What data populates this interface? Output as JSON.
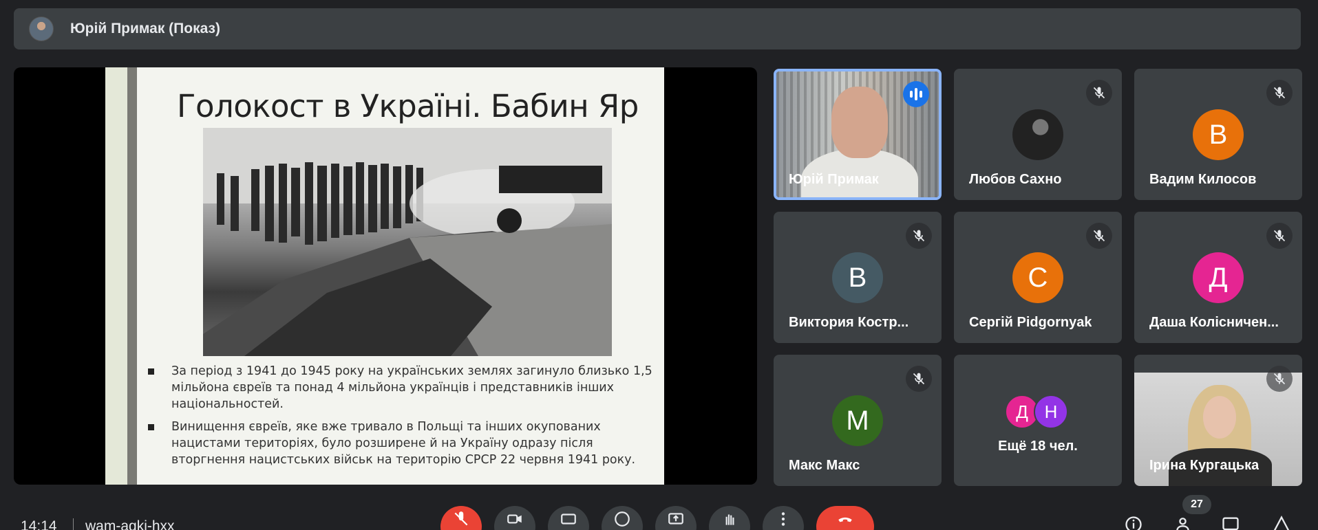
{
  "presenter": {
    "name": "Юрій Примак (Показ)"
  },
  "slide": {
    "title": "Голокост в Україні. Бабин Яр",
    "photo_caption": "",
    "bullets": [
      "За період з 1941 до 1945 року на українських землях загинуло близько 1,5 мільйона євреїв та понад 4 мільйона українців і представників інших національностей.",
      "Винищення євреїв, яке вже тривало в Польщі та інших окупованих нацистами територіях, було розширене й на Україну одразу після вторгнення нацистських військ на територію СРСР 22 червня 1941 року."
    ]
  },
  "participants": [
    {
      "name": "Юрій Примак",
      "type": "video",
      "speaking": true
    },
    {
      "name": "Любов Сахно",
      "type": "photo",
      "muted": true
    },
    {
      "name": "Вадим Килосов",
      "initial": "В",
      "color": "#e8710a",
      "muted": true
    },
    {
      "name": "Виктория Костр...",
      "initial": "В",
      "color": "#455a64",
      "muted": true
    },
    {
      "name": "Сергій Pidgornyak",
      "initial": "С",
      "color": "#e8710a",
      "muted": true
    },
    {
      "name": "Даша Колісничен...",
      "initial": "Д",
      "color": "#e52592",
      "muted": true
    },
    {
      "name": "Макс Макс",
      "initial": "М",
      "color": "#33691e",
      "muted": true
    },
    {
      "name": "Ещё 18 чел.",
      "type": "more",
      "initials": [
        "Д",
        "Н"
      ],
      "colors": [
        "#e52592",
        "#9334e6"
      ]
    },
    {
      "name": "Ірина Кургацька",
      "type": "video",
      "muted": true
    }
  ],
  "bottom_bar": {
    "time": "14:14",
    "meeting_code": "wam-agki-hxx",
    "participant_count": "27"
  },
  "icons": {
    "mic_off": "mic-off-icon",
    "camera": "camera-icon",
    "captions": "captions-icon",
    "emoji": "emoji-icon",
    "present": "present-screen-icon",
    "raise_hand": "raise-hand-icon",
    "more": "more-options-icon",
    "end_call": "end-call-icon",
    "info": "info-icon",
    "people": "people-icon",
    "chat": "chat-icon",
    "activities": "activities-icon"
  }
}
